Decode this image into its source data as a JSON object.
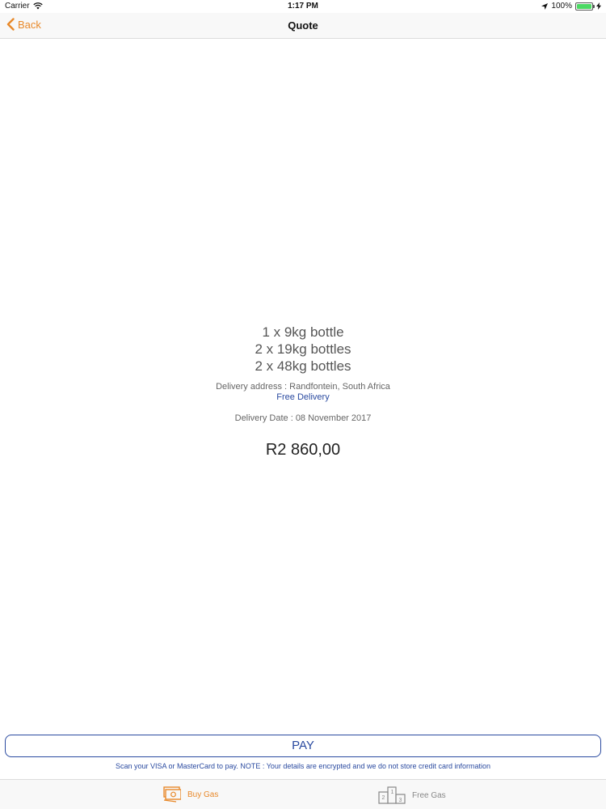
{
  "status_bar": {
    "carrier": "Carrier",
    "time": "1:17 PM",
    "battery": "100%"
  },
  "nav": {
    "back_label": "Back",
    "title": "Quote"
  },
  "order": {
    "items": [
      "1 x 9kg bottle",
      "2 x 19kg bottles",
      "2 x 48kg bottles"
    ],
    "delivery_address": "Delivery address : Randfontein, South Africa",
    "free_delivery": "Free Delivery",
    "delivery_date": "Delivery Date : 08 November 2017",
    "total": "R2 860,00"
  },
  "pay": {
    "label": "PAY",
    "note": "Scan your VISA or MasterCard to pay. NOTE : Your details are encrypted and we do not store credit card information"
  },
  "tabs": [
    {
      "label": "Buy Gas",
      "icon": "money-icon",
      "active": true
    },
    {
      "label": "Free Gas",
      "icon": "podium-icon",
      "active": false
    }
  ],
  "colors": {
    "accent": "#e8892a",
    "link": "#2a4aa0",
    "battery": "#4cd964"
  }
}
